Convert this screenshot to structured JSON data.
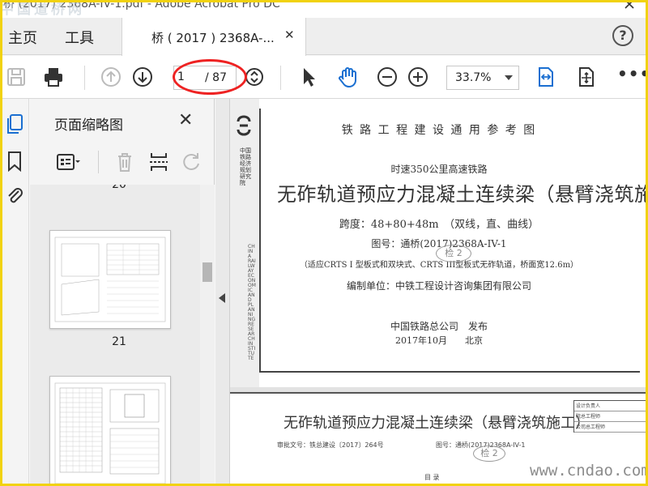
{
  "window": {
    "title": "桥 (2017) 2368A-IV-1.pdf - Adobe Acrobat Pro DC",
    "watermark": "中国道桥网"
  },
  "tabs": {
    "home": "主页",
    "tools": "工具",
    "document": "桥 ( 2017 ) 2368A-...",
    "close_glyph": "✕",
    "help_glyph": "?"
  },
  "toolbar": {
    "current_page": "1",
    "total_pages": "/ 87",
    "zoom": "33.7%",
    "more_glyph": "•••"
  },
  "thumbnails": {
    "panel_title": "页面缩略图",
    "close_glyph": "✕",
    "partial_label": "20",
    "items": [
      {
        "number": "21"
      }
    ]
  },
  "page1": {
    "header": "铁 路 工 程 建 设 通 用 参 考 图",
    "speed": "时速350公里高速铁路",
    "title": "无砟轨道预应力混凝土连续梁（悬臂浇筑施工）",
    "span": "跨度：48+80+48m　（双线，直、曲线）",
    "drawing_no": "图号：通桥(2017)2368A-IV-1",
    "applicable": "（适应CRTS I 型板式和双块式、CRTS III型板式无砟轨道，桥面宽12.6m）",
    "editor": "编制单位：中铁工程设计咨询集团有限公司",
    "publisher": "中国铁路总公司　发布",
    "date": "2017年10月　　北京",
    "stamp": "检 2",
    "side_text": "中国铁路经济规划研究院",
    "side_text_en": "CHINA RAILWAY ECONOMIC AND PLANNING RESEARCH INSTITUTE"
  },
  "page2": {
    "title": "无砟轨道预应力混凝土连续梁（悬臂浇筑施工）",
    "approval": "审批文号：铁总建设〔2017〕264号",
    "drawing_no": "图号：通桥(2017)2368A-IV-1",
    "stamp": "检 2",
    "table_rows": [
      "设计负责人",
      "院总工程师",
      "公司总工程师"
    ],
    "footer": "目 录"
  },
  "site_watermark": "www.cndao.com"
}
